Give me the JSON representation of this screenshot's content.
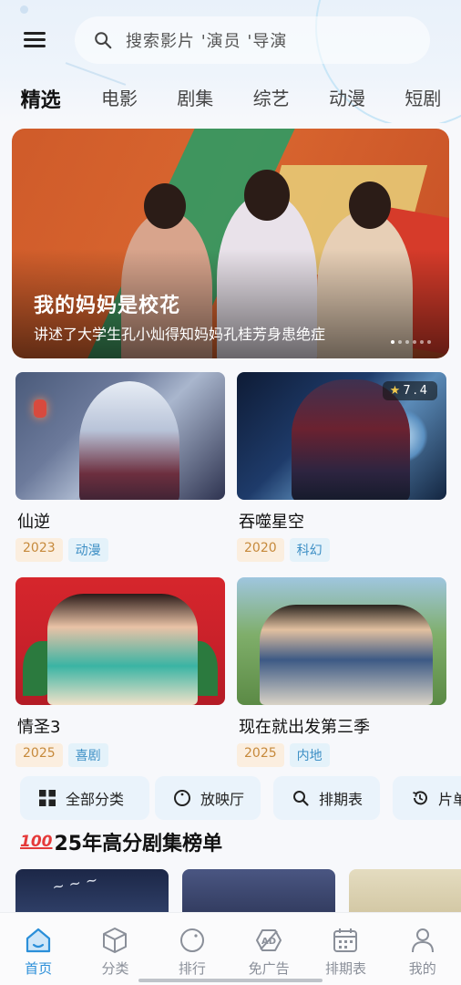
{
  "search": {
    "placeholder": "搜索影片 '演员 '导演"
  },
  "tabs": [
    "精选",
    "电影",
    "剧集",
    "综艺",
    "动漫",
    "短剧"
  ],
  "banner": {
    "title": "我的妈妈是校花",
    "description": "讲述了大学生孔小灿得知妈妈孔桂芳身患绝症",
    "page_count": 6,
    "active_page": 0
  },
  "cards": [
    {
      "title": "仙逆",
      "year": "2023",
      "genre": "动漫"
    },
    {
      "title": "吞噬星空",
      "year": "2020",
      "genre": "科幻",
      "rating": "7.4"
    },
    {
      "title": "情圣3",
      "year": "2025",
      "genre": "喜剧"
    },
    {
      "title": "现在就出发第三季",
      "year": "2025",
      "genre": "内地"
    }
  ],
  "quick_actions": [
    {
      "label": "全部分类",
      "icon": "grid-icon"
    },
    {
      "label": "放映厅",
      "icon": "clock-circle-icon"
    },
    {
      "label": "排期表",
      "icon": "search-icon"
    },
    {
      "label": "片单",
      "icon": "history-icon"
    }
  ],
  "ranking": {
    "badge": "100",
    "title": "25年高分剧集榜单"
  },
  "tabbar": [
    {
      "label": "首页",
      "icon": "home-icon",
      "active": true
    },
    {
      "label": "分类",
      "icon": "cube-icon"
    },
    {
      "label": "排行",
      "icon": "ranking-icon"
    },
    {
      "label": "免广告",
      "icon": "no-ads-icon"
    },
    {
      "label": "排期表",
      "icon": "calendar-icon"
    },
    {
      "label": "我的",
      "icon": "user-icon"
    }
  ],
  "colors": {
    "accent": "#2b8fd9",
    "year_tag": "#c6893b",
    "genre_tag": "#3d8fc5"
  }
}
